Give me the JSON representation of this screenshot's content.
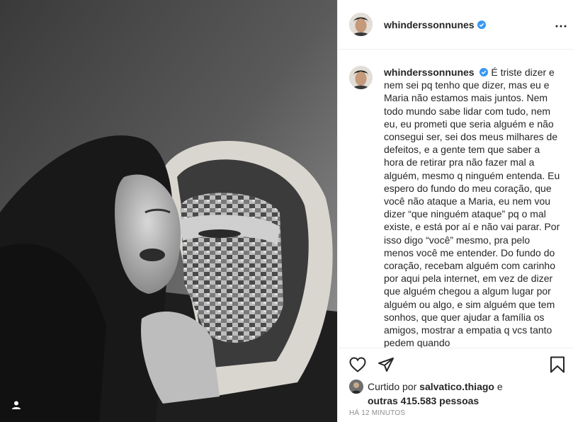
{
  "post": {
    "username": "whinderssonnunes",
    "caption_user": "whinderssonnunes",
    "caption": "É triste dizer e nem sei pq tenho que dizer, mas eu e Maria não estamos mais juntos. Nem todo mundo sabe lidar com tudo, nem eu, eu prometi que seria alguém e não consegui ser, sei dos meus milhares de defeitos, e a gente tem que saber a hora de retirar pra não fazer mal a alguém, mesmo q ninguém entenda. Eu espero do fundo do meu coração, que você não ataque a Maria, eu nem vou dizer “que ninguém ataque” pq o mal existe, e está por aí e não vai parar. Por isso digo “você” mesmo, pra pelo menos você me entender. Do fundo do coração, recebam alguém com carinho por aqui pela internet, em vez de dizer que alguém chegou a algum lugar por alguém ou algo, e sim alguém que tem sonhos, que quer ajudar a família os amigos, mostrar a empatia q vcs tanto pedem quando",
    "likes_prefix": "Curtido por",
    "liked_by": "salvatico.thiago",
    "likes_joiner": "e",
    "likes_others": "outras 415.583 pessoas",
    "time_ago": "HÁ 12 MINUTOS"
  },
  "colors": {
    "verified": "#3897f0",
    "border": "#efefef",
    "text": "#262626",
    "muted": "#8e8e8e"
  },
  "icons": [
    "verified-badge-icon",
    "more-options-icon",
    "heart-icon",
    "share-icon",
    "bookmark-icon",
    "user-tag-icon"
  ]
}
